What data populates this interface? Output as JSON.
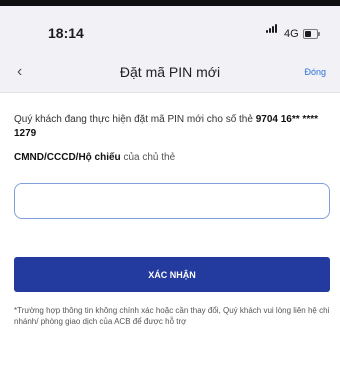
{
  "status_bar": {
    "time": "18:14",
    "network": "4G"
  },
  "header": {
    "back_glyph": "‹",
    "title": "Đặt mã PIN mới",
    "close_label": "Đóng"
  },
  "form": {
    "description_prefix": "Quý khách đang thực hiện đặt mã PIN mới cho số thẻ",
    "card_number": "9704 16** **** 1279",
    "id_label_bold": "CMND/CCCD/Hộ chiếu",
    "id_label_suffix": "của chủ thẻ",
    "id_input_value": "",
    "confirm_label": "XÁC NHẬN",
    "note": "*Trường hợp thông tin không chính xác hoặc cần thay đổi, Quý khách vui lòng liên hệ chi nhánh/ phòng giao dịch của ACB để được hỗ trợ"
  },
  "colors": {
    "primary_button": "#233b9e",
    "input_border": "#7fa0d8",
    "header_link": "#2c6fd6",
    "nav_background": "#f2f2f6"
  },
  "icons": {
    "signal": "signal-bars-icon",
    "battery": "battery-icon",
    "back": "chevron-left-icon"
  }
}
